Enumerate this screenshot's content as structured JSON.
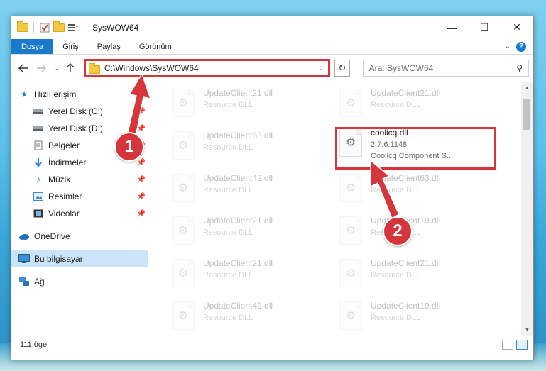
{
  "window": {
    "title": "SysWOW64",
    "controls": {
      "minimize": "—",
      "maximize": "☐",
      "close": "✕"
    }
  },
  "ribbon": {
    "tabs": [
      {
        "label": "Dosya"
      },
      {
        "label": "Giriş"
      },
      {
        "label": "Paylaş"
      },
      {
        "label": "Görünüm"
      }
    ],
    "help": "?"
  },
  "navigation": {
    "address": "C:\\Windows\\SysWOW64",
    "search_placeholder": "Ara: SysWOW64"
  },
  "sidebar": {
    "quick_access": "Hızlı erişim",
    "items": [
      {
        "label": "Yerel Disk (C:)",
        "pinned": true
      },
      {
        "label": "Yerel Disk (D:)",
        "pinned": true
      },
      {
        "label": "Belgeler",
        "pinned": true
      },
      {
        "label": "İndirmeler",
        "pinned": true
      },
      {
        "label": "Müzik",
        "pinned": true
      },
      {
        "label": "Resimler",
        "pinned": true
      },
      {
        "label": "Videolar",
        "pinned": true
      }
    ],
    "onedrive": "OneDrive",
    "this_pc": "Bu bilgisayar",
    "network": "Ağ"
  },
  "files": {
    "left_column": [
      {
        "name": "UpdateClient21.dll",
        "meta": "Resource DLL"
      },
      {
        "name": "UpdateClient63.dll",
        "meta": "Resource DLL"
      },
      {
        "name": "UpdateClient42.dll",
        "meta": "Resource DLL"
      },
      {
        "name": "UpdateClient21.dll",
        "meta": "Resource DLL"
      },
      {
        "name": "UpdateClient21.dll",
        "meta": "Resource DLL"
      },
      {
        "name": "UpdateClient42.dll",
        "meta": "Resource DLL"
      }
    ],
    "right_column": [
      {
        "name": "UpdateClient21.dll",
        "meta": "Resource DLL"
      },
      {
        "name": "UpdateClient63.dll",
        "meta": "Resource DLL"
      },
      {
        "name": "UpdateClient19.dll",
        "meta": "Resource DLL"
      },
      {
        "name": "UpdateClient21.dll",
        "meta": "Resource DLL"
      },
      {
        "name": "UpdateClient19.dll",
        "meta": "Resource DLL"
      }
    ],
    "highlighted": {
      "name": "coolicq.dll",
      "version": "2.7.6.1148",
      "description": "Coollcq Component S..."
    }
  },
  "annotations": {
    "badge_1": "1",
    "badge_2": "2",
    "color": "#d5353b"
  },
  "status": {
    "count": "111 öge"
  }
}
